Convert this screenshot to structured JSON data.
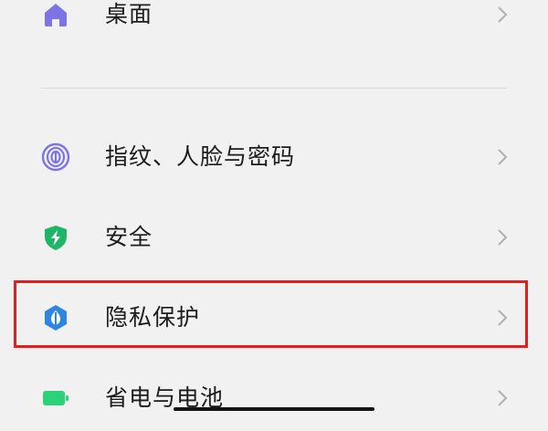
{
  "settings": {
    "items": [
      {
        "label": "桌面",
        "icon": "home-icon"
      },
      {
        "label": "指纹、人脸与密码",
        "icon": "fingerprint-icon"
      },
      {
        "label": "安全",
        "icon": "shield-bolt-icon"
      },
      {
        "label": "隐私保护",
        "icon": "privacy-shield-icon"
      },
      {
        "label": "省电与电池",
        "icon": "battery-icon"
      }
    ],
    "highlighted_item": "隐私保护"
  },
  "colors": {
    "background": "#f1f1f1",
    "home_icon": "#7b73e6",
    "fingerprint_icon": "#7b73e6",
    "security_icon": "#1fb568",
    "privacy_icon": "#2f86e0",
    "battery_icon": "#2bd27a",
    "highlight_border": "#e51d1d",
    "chevron": "#b0b0b0"
  }
}
